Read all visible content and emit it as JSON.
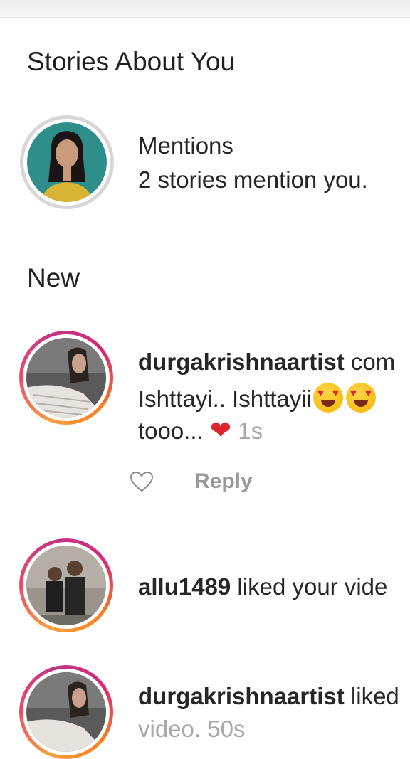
{
  "stories_about_you": {
    "title": "Stories About You",
    "mentions": {
      "title": "Mentions",
      "subtitle": "2 stories mention you."
    }
  },
  "new_section": {
    "title": "New",
    "items": [
      {
        "username": "durgakrishnaartist",
        "action": " com",
        "comment_line1": "Ishttayi.. Ishttayii",
        "comment_line2": "tooo... ",
        "time": "1s",
        "reply_label": "Reply"
      },
      {
        "username": "allu1489",
        "action": " liked your vide"
      },
      {
        "username": "durgakrishnaartist",
        "action": " liked",
        "line2": "video. 50s"
      }
    ]
  },
  "colors": {
    "story_ring_grey": "#d6d6d6",
    "story_ring_gradient": [
      "#f9a03f",
      "#e94b6a",
      "#c13584"
    ],
    "heart": "#e0242e",
    "muted": "#a8a8a8"
  },
  "icons": [
    "heart-emoji",
    "heart-eyes-emoji",
    "heart-outline-icon"
  ]
}
